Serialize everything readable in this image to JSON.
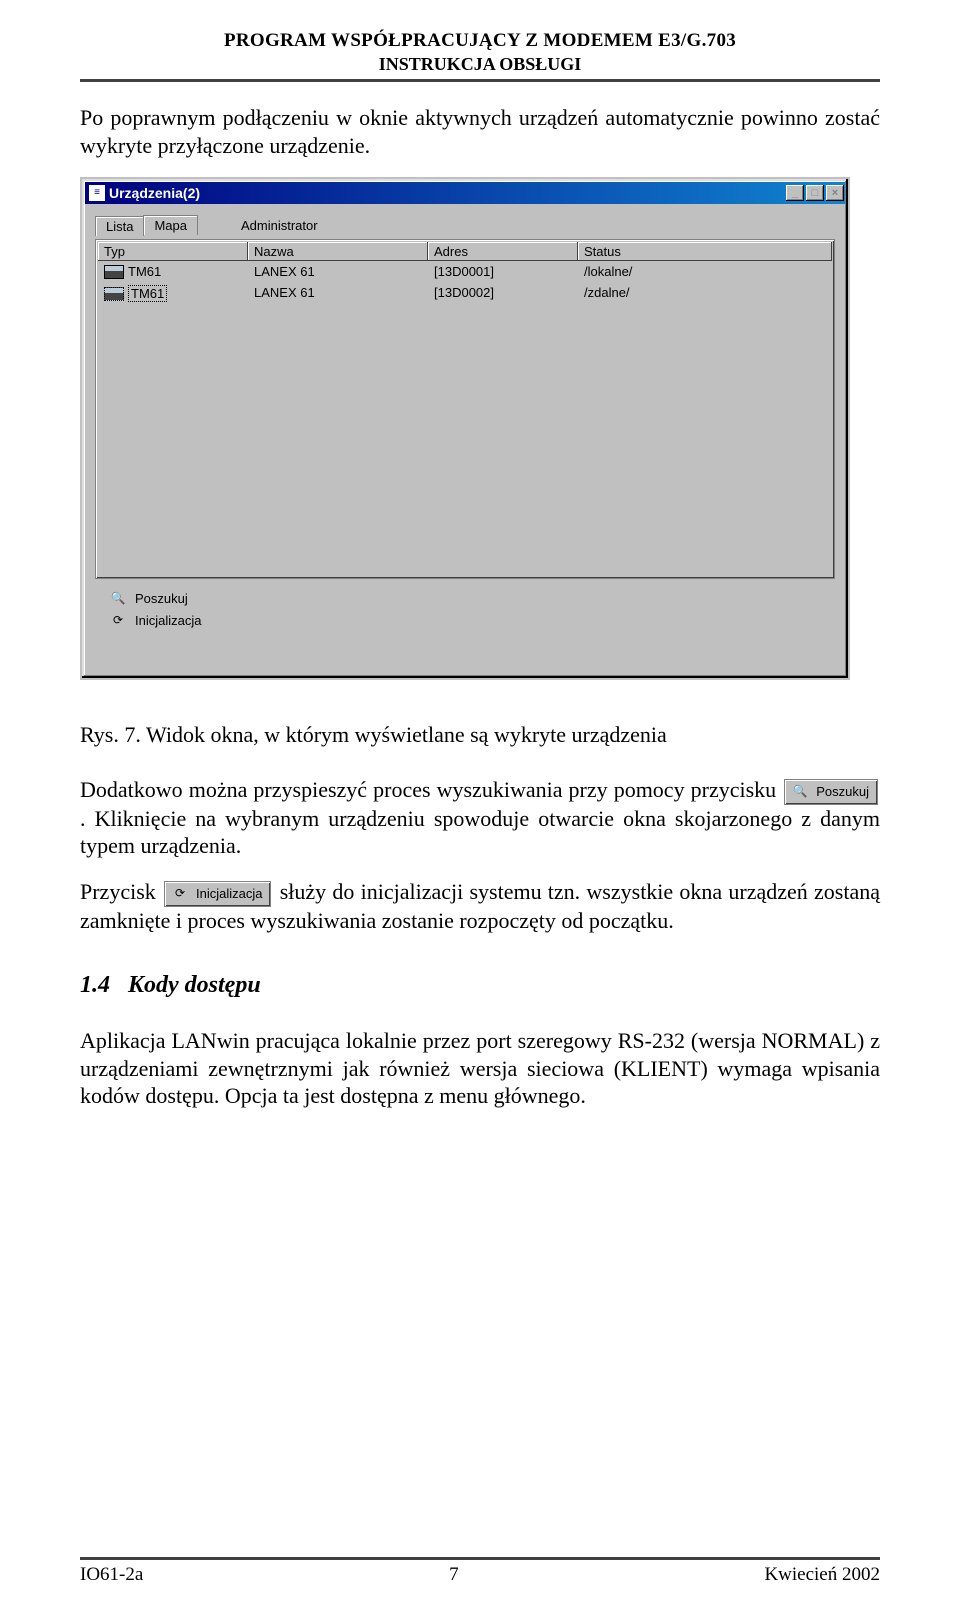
{
  "doc_header": {
    "title": "PROGRAM WSPÓŁPRACUJĄCY Z MODEMEM E3/G.703",
    "subtitle": "INSTRUKCJA OBSŁUGI"
  },
  "para1": "Po poprawnym podłączeniu w oknie aktywnych urządzeń automatycznie powinno zostać wykryte przyłączone urządzenie.",
  "window": {
    "title": "Urządzenia(2)",
    "tabs": {
      "lista": "Lista",
      "mapa": "Mapa"
    },
    "admin_label": "Administrator",
    "columns": {
      "typ": "Typ",
      "nazwa": "Nazwa",
      "adres": "Adres",
      "status": "Status"
    },
    "rows": [
      {
        "typ": "TM61",
        "nazwa": "LANEX 61",
        "adres": "[13D0001]",
        "status": "/lokalne/"
      },
      {
        "typ": "TM61",
        "nazwa": "LANEX 61",
        "adres": "[13D0002]",
        "status": "/zdalne/"
      }
    ],
    "buttons": {
      "poszukuj": "Poszukuj",
      "inicjalizacja": "Inicjalizacja"
    }
  },
  "caption": "Rys. 7. Widok okna, w którym wyświetlane są wykryte urządzenia",
  "para2_a": "Dodatkowo można przyspieszyć proces wyszukiwania przy pomocy przycisku ",
  "para2_b": ". Kliknięcie na wybranym urządzeniu spowoduje otwarcie okna skojarzonego z danym typem urządzenia.",
  "para3_a": "Przycisk ",
  "para3_b": " służy do inicjalizacji systemu tzn. wszystkie okna urządzeń zostaną zamknięte i proces wyszukiwania zostanie rozpoczęty od początku.",
  "section": {
    "num": "1.4",
    "title": "Kody dostępu"
  },
  "para4": "Aplikacja LANwin pracująca lokalnie przez port szeregowy RS-232 (wersja NORMAL) z urządzeniami zewnętrznymi jak również wersja sieciowa (KLIENT) wymaga wpisania kodów dostępu. Opcja ta jest dostępna z menu głównego.",
  "footer": {
    "left": "IO61-2a",
    "center": "7",
    "right": "Kwiecień 2002"
  }
}
